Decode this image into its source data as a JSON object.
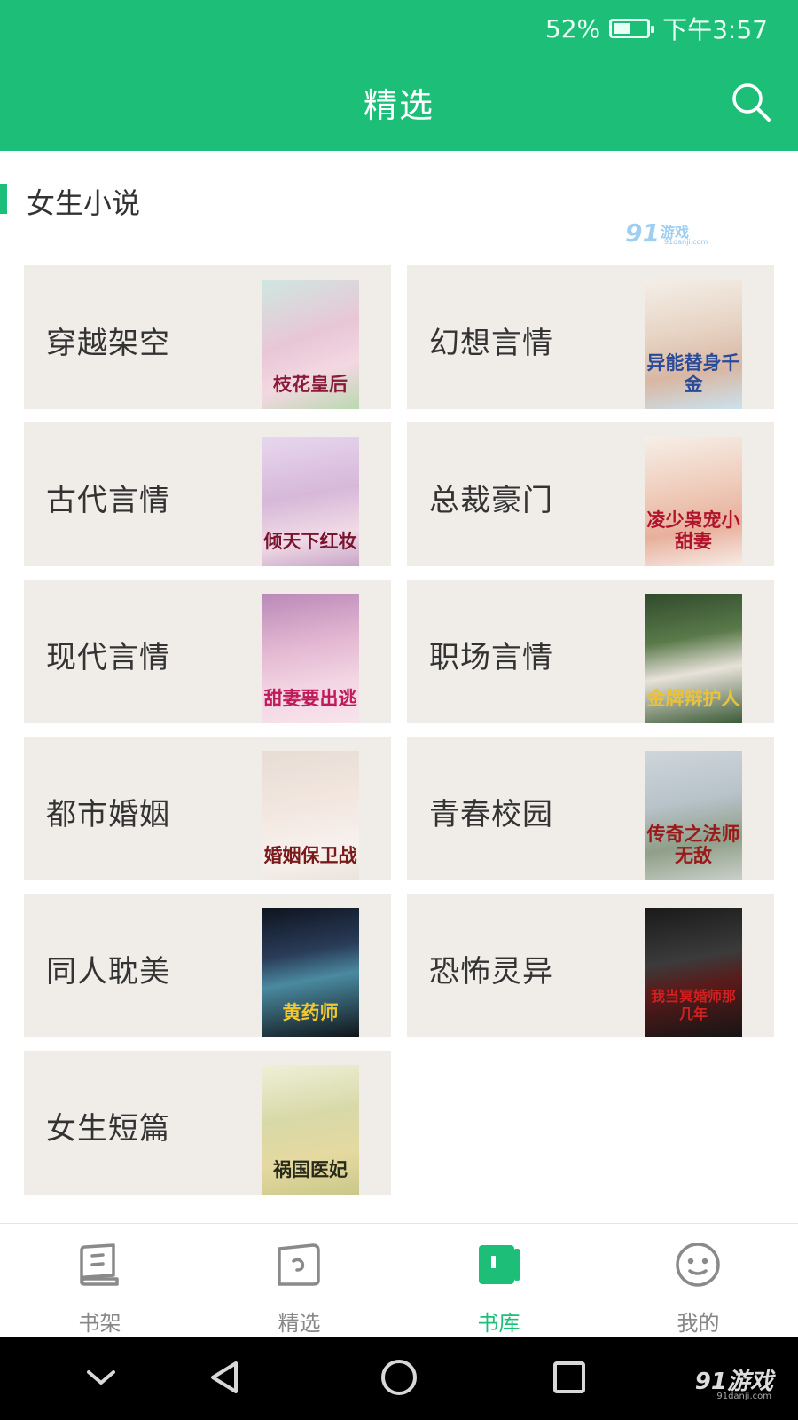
{
  "status": {
    "battery_percent": "52%",
    "battery_level": 0.52,
    "time": "下午3:57"
  },
  "header": {
    "title": "精选",
    "search_icon": "search-icon"
  },
  "section": {
    "title": "女生小说"
  },
  "watermark": {
    "logo": "91",
    "text": "游戏",
    "url": "91danji.com"
  },
  "categories": [
    {
      "name": "穿越架空",
      "cover_title": "枝花皇后"
    },
    {
      "name": "幻想言情",
      "cover_title": "异能替身千金"
    },
    {
      "name": "古代言情",
      "cover_title": "倾天下红妆"
    },
    {
      "name": "总裁豪门",
      "cover_title": "凌少枭宠小甜妻"
    },
    {
      "name": "现代言情",
      "cover_title": "甜妻要出逃"
    },
    {
      "name": "职场言情",
      "cover_title": "金牌辩护人"
    },
    {
      "name": "都市婚姻",
      "cover_title": "婚姻保卫战"
    },
    {
      "name": "青春校园",
      "cover_title": "传奇之法师无敌"
    },
    {
      "name": "同人耽美",
      "cover_title": "黄药师"
    },
    {
      "name": "恐怖灵异",
      "cover_title": "我当冥婚师那几年"
    },
    {
      "name": "女生短篇",
      "cover_title": "祸国医妃"
    }
  ],
  "bottom_nav": [
    {
      "label": "书架",
      "icon": "bookshelf-icon",
      "active": false
    },
    {
      "label": "精选",
      "icon": "featured-icon",
      "active": false
    },
    {
      "label": "书库",
      "icon": "library-icon",
      "active": true
    },
    {
      "label": "我的",
      "icon": "profile-icon",
      "active": false
    }
  ],
  "system_nav": [
    "collapse-icon",
    "back-icon",
    "home-icon",
    "recents-icon"
  ],
  "colors": {
    "brand": "#1dbf78",
    "card_bg": "#f0ece8",
    "nav_inactive": "#888888"
  }
}
